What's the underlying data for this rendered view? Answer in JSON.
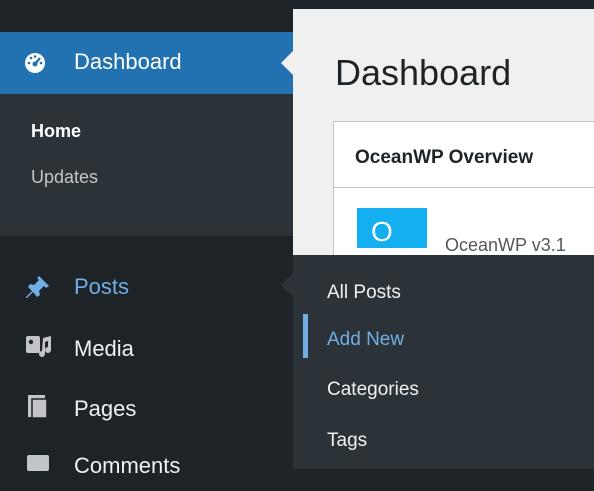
{
  "sidebar": {
    "dashboard_label": "Dashboard",
    "dashboard_submenu": {
      "home": "Home",
      "updates": "Updates"
    },
    "items": [
      {
        "label": "Posts",
        "icon": "pin-icon"
      },
      {
        "label": "Media",
        "icon": "media-icon"
      },
      {
        "label": "Pages",
        "icon": "pages-icon"
      },
      {
        "label": "Comments",
        "icon": "comments-icon"
      }
    ]
  },
  "main": {
    "title": "Dashboard",
    "card": {
      "title": "OceanWP Overview",
      "logo_letter": "O",
      "version": "OceanWP v3.1"
    }
  },
  "posts_flyout": {
    "items": [
      "All Posts",
      "Add New",
      "Categories",
      "Tags"
    ],
    "active": "Add New"
  },
  "colors": {
    "sidebar_bg": "#1d2327",
    "submenu_bg": "#2c3338",
    "active_bg": "#2271b1",
    "highlight": "#72aee6",
    "content_bg": "#f0f0f1",
    "logo": "#13aff0"
  }
}
